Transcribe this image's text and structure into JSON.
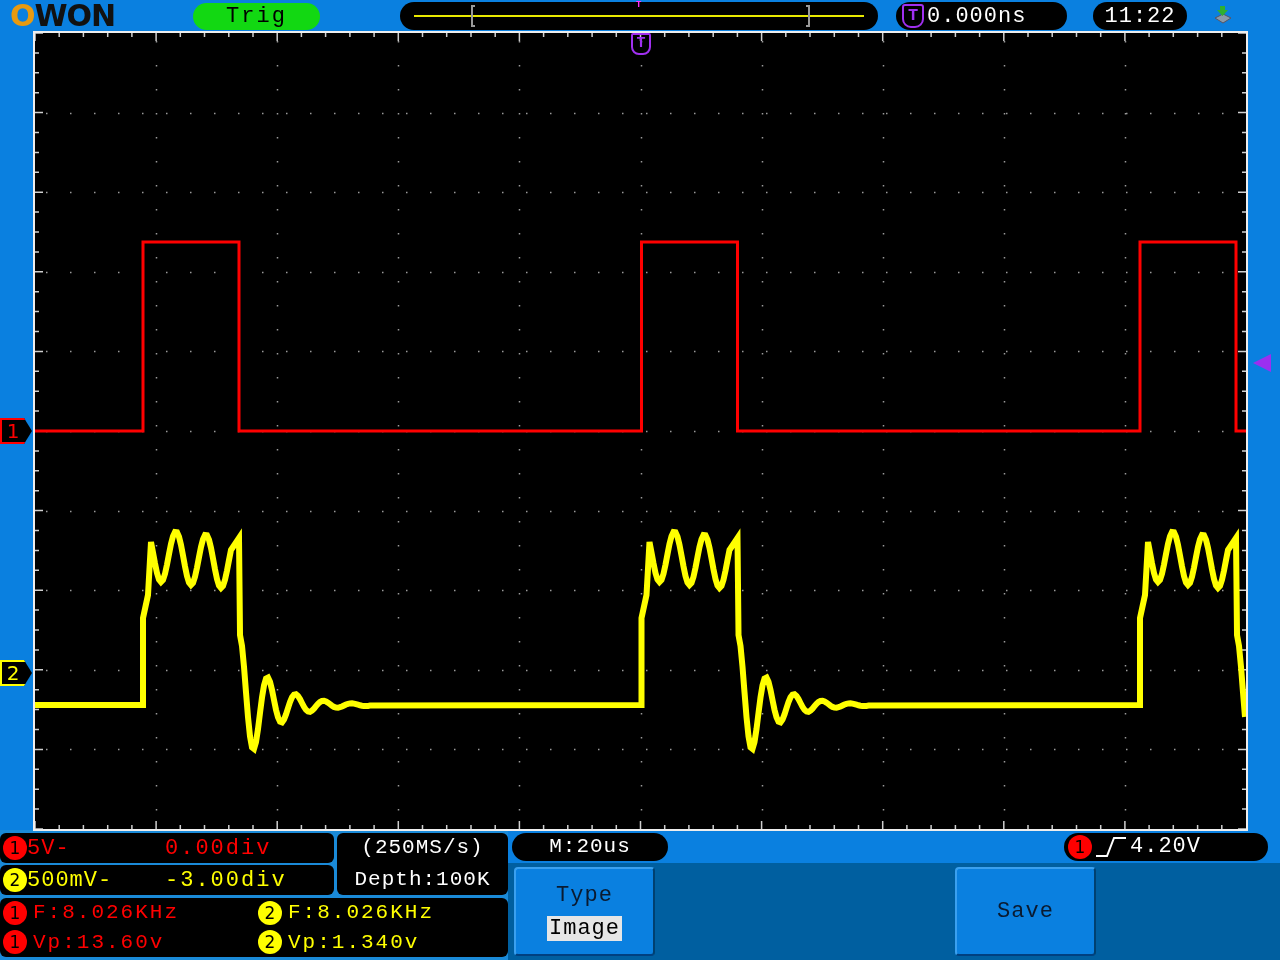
{
  "header": {
    "logo": "OWON",
    "trigger_status": "Trig",
    "timeline_marker": "T",
    "trigger_icon": "T",
    "trigger_position": "0.000ns",
    "clock": "11:22"
  },
  "display": {
    "trigger_marker": "T"
  },
  "channels": [
    {
      "marker": "1",
      "badge": "1",
      "color": "#ff0000",
      "scale": "5V-",
      "offset": "0.00div"
    },
    {
      "marker": "2",
      "badge": "2",
      "color": "#ffff00",
      "scale": "500mV-",
      "offset": "-3.00div"
    }
  ],
  "sampling": {
    "rate": "(250MS/s)",
    "depth": "Depth:100K"
  },
  "timebase": "M:20us",
  "trigger_level": {
    "badge": "1",
    "color": "#ff0000",
    "level": "4.20V"
  },
  "measurements": [
    {
      "badge": "1",
      "color": "#ff0000",
      "text": "F:8.026KHz"
    },
    {
      "badge": "2",
      "color": "#ffff00",
      "text": "F:8.026KHz"
    },
    {
      "badge": "1",
      "color": "#ff0000",
      "text": "Vp:13.60v"
    },
    {
      "badge": "2",
      "color": "#ffff00",
      "text": "Vp:1.340v"
    }
  ],
  "menu": [
    {
      "kind": "option",
      "title": "Type",
      "value": "Image"
    },
    {
      "kind": "action",
      "label": "Save"
    }
  ]
}
